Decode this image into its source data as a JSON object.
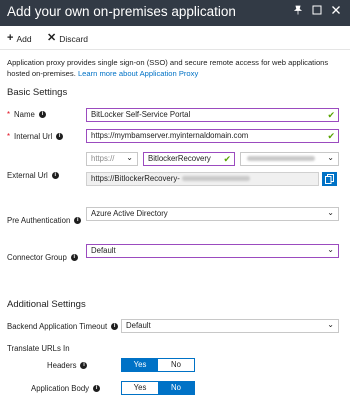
{
  "window": {
    "title": "Add your own on-premises application",
    "pin_icon": "pin-icon",
    "maximize_icon": "maximize-icon",
    "close_icon": "close-icon"
  },
  "toolbar": {
    "add_label": "Add",
    "discard_label": "Discard"
  },
  "description": {
    "text": "Application proxy provides single sign-on (SSO) and secure remote access for web applications hosted on-premises.",
    "link": "Learn more about Application Proxy"
  },
  "basic": {
    "title": "Basic Settings",
    "name_label": "Name",
    "name_value": "BitLocker Self-Service Portal",
    "internal_url_label": "Internal Url",
    "internal_url_value": "https://mymbamserver.myinternaldomain.com",
    "external_url_label": "External Url",
    "scheme_value": "https://",
    "subdomain_value": "BitlockerRecovery",
    "external_url_prefix": "https://BitlockerRecovery-",
    "pre_auth_label": "Pre Authentication",
    "pre_auth_value": "Azure Active Directory",
    "connector_group_label": "Connector Group",
    "connector_group_value": "Default"
  },
  "additional": {
    "title": "Additional Settings",
    "backend_timeout_label": "Backend Application Timeout",
    "backend_timeout_value": "Default",
    "translate_urls_label": "Translate URLs In",
    "headers_label": "Headers",
    "headers_yes": "Yes",
    "headers_no": "No",
    "body_label": "Application Body",
    "body_yes": "Yes",
    "body_no": "No",
    "headers_selected": "Yes",
    "body_selected": "No"
  },
  "colors": {
    "title_bar": "#323a45",
    "accent": "#0072c6",
    "valid_border": "#9b4bbf",
    "check": "#57a300",
    "required": "#e00b1c"
  }
}
